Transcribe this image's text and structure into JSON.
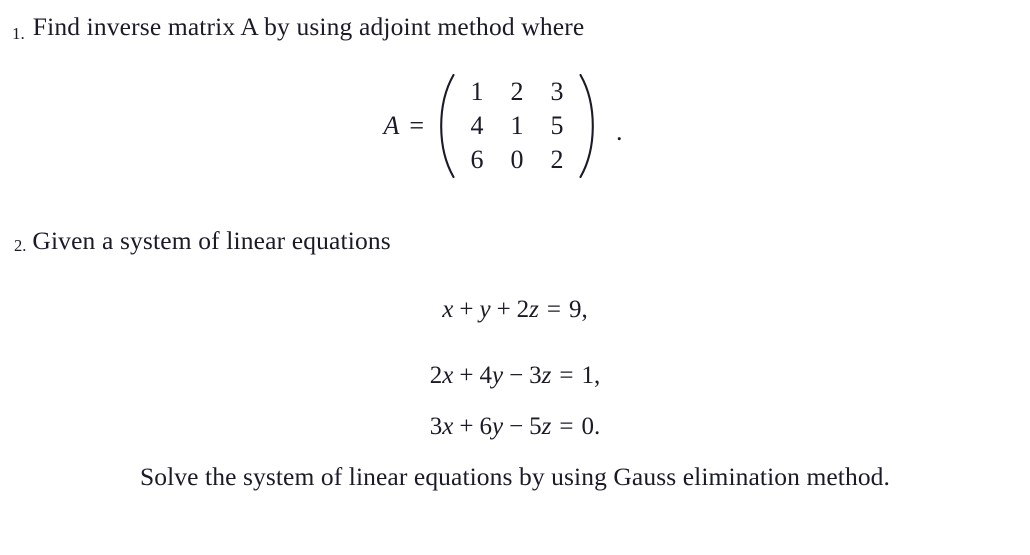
{
  "document": {
    "background_color": "#ffffff",
    "text_color": "#1a1a28"
  },
  "problems": [
    {
      "number": "1.",
      "prompt": "Find inverse matrix A by using adjoint method where",
      "matrix": {
        "label": "A",
        "equals": "=",
        "rows": [
          [
            "1",
            "2",
            "3"
          ],
          [
            "4",
            "1",
            "5"
          ],
          [
            "6",
            "0",
            "2"
          ]
        ],
        "trailing_punctuation": "."
      }
    },
    {
      "number": "2.",
      "prompt": "Given a system of linear equations",
      "equations": [
        {
          "terms": [
            {
              "text": "x",
              "style": "var"
            },
            {
              "text": "+",
              "style": "op"
            },
            {
              "text": "y",
              "style": "var"
            },
            {
              "text": "+",
              "style": "op"
            },
            {
              "text": "2",
              "style": "num"
            },
            {
              "text": "z",
              "style": "var"
            },
            {
              "text": "=",
              "style": "rel"
            },
            {
              "text": "9,",
              "style": "num"
            }
          ],
          "plain": "x + y + 2z = 9,"
        },
        {
          "terms": [
            {
              "text": "2",
              "style": "num"
            },
            {
              "text": "x",
              "style": "var"
            },
            {
              "text": "+",
              "style": "op"
            },
            {
              "text": "4",
              "style": "num"
            },
            {
              "text": "y",
              "style": "var"
            },
            {
              "text": "−",
              "style": "op"
            },
            {
              "text": "3",
              "style": "num"
            },
            {
              "text": "z",
              "style": "var"
            },
            {
              "text": "=",
              "style": "rel"
            },
            {
              "text": "1,",
              "style": "num"
            }
          ],
          "plain": "2x + 4y − 3z = 1,"
        },
        {
          "terms": [
            {
              "text": "3",
              "style": "num"
            },
            {
              "text": "x",
              "style": "var"
            },
            {
              "text": "+",
              "style": "op"
            },
            {
              "text": "6",
              "style": "num"
            },
            {
              "text": "y",
              "style": "var"
            },
            {
              "text": "−",
              "style": "op"
            },
            {
              "text": "5",
              "style": "num"
            },
            {
              "text": "z",
              "style": "var"
            },
            {
              "text": "=",
              "style": "rel"
            },
            {
              "text": "0.",
              "style": "num"
            }
          ],
          "plain": "3x + 6y − 5z = 0."
        }
      ],
      "closing": "Solve the system of linear equations by using Gauss elimination method."
    }
  ]
}
